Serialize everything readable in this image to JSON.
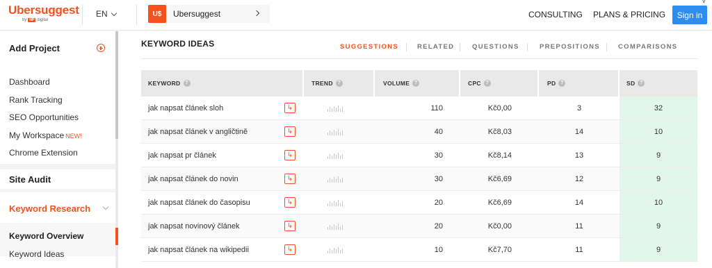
{
  "header": {
    "logo": "Ubersuggest",
    "logo_by": "by",
    "logo_np": "NP",
    "logo_digital": "digital",
    "language": "EN",
    "project_badge": "U$",
    "project_name": "Ubersuggest",
    "nav": [
      "CONSULTING",
      "PLANS & PRICING"
    ],
    "signin": "Sign in",
    "corner_mark": "˅"
  },
  "sidebar": {
    "add_project": "Add Project",
    "items": [
      "Dashboard",
      "Rank Tracking",
      "SEO Opportunities",
      "My Workspace",
      "Chrome Extension"
    ],
    "new_badge": "NEW!",
    "site_audit": "Site Audit",
    "keyword_research": "Keyword Research",
    "sub_items": [
      "Keyword Overview",
      "Keyword Ideas"
    ]
  },
  "main": {
    "title": "KEYWORD IDEAS",
    "tabs": [
      "SUGGESTIONS",
      "RELATED",
      "QUESTIONS",
      "PREPOSITIONS",
      "COMPARISONS"
    ],
    "active_tab": "SUGGESTIONS"
  },
  "table": {
    "columns": [
      "KEYWORD",
      "TREND",
      "VOLUME",
      "CPC",
      "PD",
      "SD"
    ],
    "help_glyph": "?",
    "goto_glyph": "↳",
    "rows": [
      {
        "keyword": "jak napsat článek sloh",
        "volume": "110",
        "cpc": "Kč0,00",
        "pd": "3",
        "sd": "32"
      },
      {
        "keyword": "jak napsat článek v angličtině",
        "volume": "40",
        "cpc": "Kč8,03",
        "pd": "14",
        "sd": "10"
      },
      {
        "keyword": "jak napsat pr článek",
        "volume": "30",
        "cpc": "Kč8,14",
        "pd": "13",
        "sd": "9"
      },
      {
        "keyword": "jak napsat článek do novin",
        "volume": "30",
        "cpc": "Kč6,69",
        "pd": "12",
        "sd": "9"
      },
      {
        "keyword": "jak napsat článek do časopisu",
        "volume": "20",
        "cpc": "Kč6,69",
        "pd": "14",
        "sd": "10"
      },
      {
        "keyword": "jak napsat novinový článek",
        "volume": "20",
        "cpc": "Kč0,00",
        "pd": "11",
        "sd": "9"
      },
      {
        "keyword": "jak napsat článek na wikipedii",
        "volume": "10",
        "cpc": "Kč7,70",
        "pd": "11",
        "sd": "9"
      }
    ]
  },
  "colors": {
    "brand": "#f4511e",
    "signin": "#2d8cf0",
    "sd_highlight": "#e3f6ec"
  }
}
